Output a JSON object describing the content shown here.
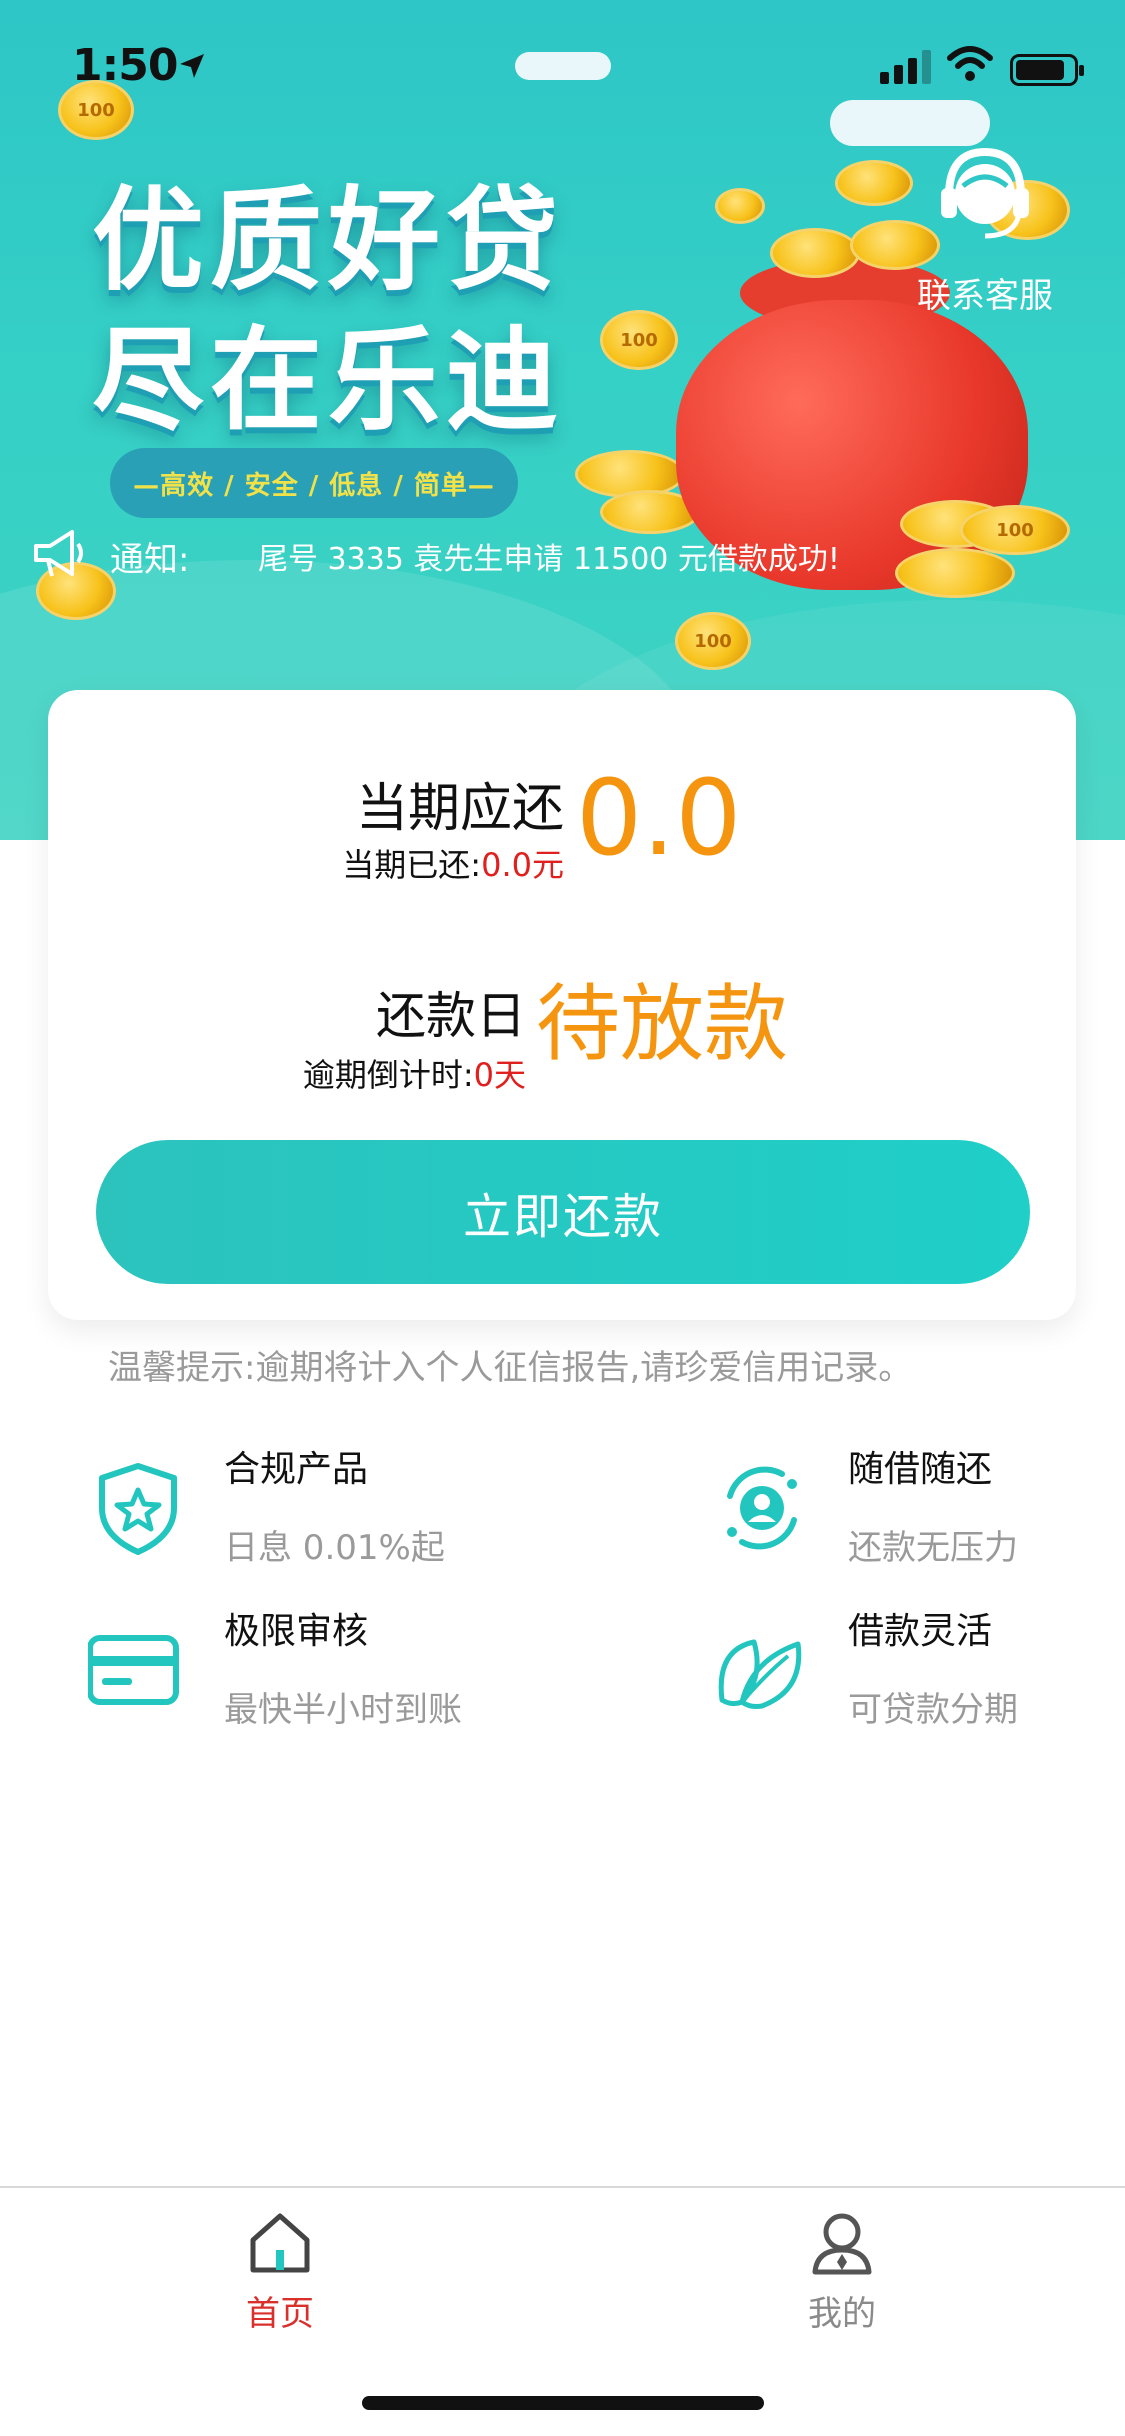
{
  "status_bar": {
    "time": "1:50"
  },
  "hero": {
    "headline_line1": "优质好贷",
    "headline_line2": "尽在乐迪",
    "tagline": "—高效 / 安全 / 低息 / 简单—",
    "coin_label": "100",
    "support_label": "联系客服",
    "notice_label": "通知:",
    "notice_text": "尾号 3335 袁先生申请 11500 元借款成功!"
  },
  "repayment_card": {
    "current_due_label": "当期应还",
    "current_paid_label": "当期已还:",
    "current_paid_value": "0.0元",
    "current_due_amount": "0.0",
    "due_date_label": "还款日",
    "overdue_countdown_label": "逾期倒计时:",
    "overdue_countdown_value": "0天",
    "due_date_value": "待放款",
    "repay_button": "立即还款"
  },
  "tip": "温馨提示:逾期将计入个人征信报告,请珍爱信用记录。",
  "features": [
    {
      "title": "合规产品",
      "desc": "日息 0.01%起",
      "icon": "shield-star-icon"
    },
    {
      "title": "随借随还",
      "desc": "还款无压力",
      "icon": "user-cycle-icon"
    },
    {
      "title": "极限审核",
      "desc": "最快半小时到账",
      "icon": "card-icon"
    },
    {
      "title": "借款灵活",
      "desc": "可贷款分期",
      "icon": "leaf-icon"
    }
  ],
  "tabbar": {
    "tabs": [
      {
        "label": "首页",
        "icon": "home-icon",
        "active": true
      },
      {
        "label": "我的",
        "icon": "profile-icon",
        "active": false
      }
    ],
    "active_color": "#d9302c",
    "inactive_color": "#8a8a8a"
  },
  "colors": {
    "accent": "#22c6bf",
    "amount": "#f5950f",
    "alert": "#e0201e"
  }
}
